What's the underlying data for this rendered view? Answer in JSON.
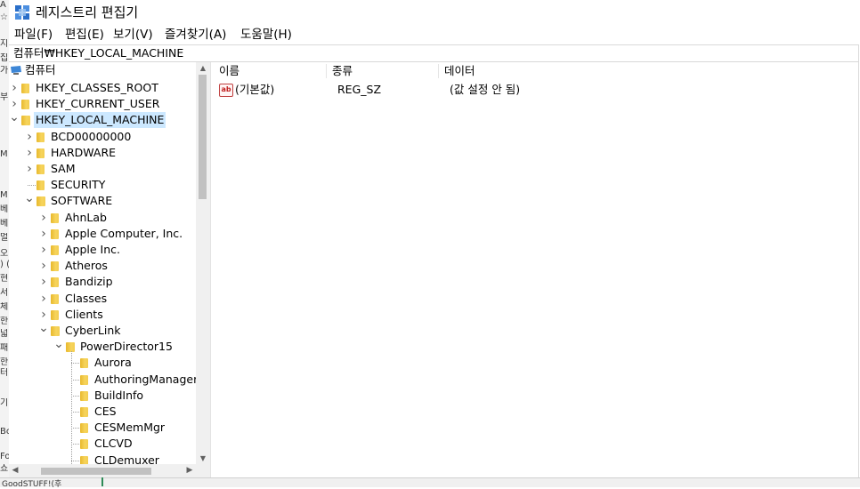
{
  "window": {
    "title": "레지스트리 편집기"
  },
  "menu": [
    "파일(F)",
    "편집(E)",
    "보기(V)",
    "즐겨찾기(A)",
    "도움말(H)"
  ],
  "address": "컴퓨터₩HKEY_LOCAL_MACHINE",
  "tree": {
    "root": "컴퓨터",
    "items": [
      {
        "label": "HKEY_CLASSES_ROOT",
        "level": 1,
        "state": "collapsed"
      },
      {
        "label": "HKEY_CURRENT_USER",
        "level": 1,
        "state": "collapsed"
      },
      {
        "label": "HKEY_LOCAL_MACHINE",
        "level": 1,
        "state": "expanded",
        "selected": true
      },
      {
        "label": "BCD00000000",
        "level": 2,
        "state": "collapsed"
      },
      {
        "label": "HARDWARE",
        "level": 2,
        "state": "collapsed"
      },
      {
        "label": "SAM",
        "level": 2,
        "state": "collapsed"
      },
      {
        "label": "SECURITY",
        "level": 2,
        "state": "leaf"
      },
      {
        "label": "SOFTWARE",
        "level": 2,
        "state": "expanded"
      },
      {
        "label": "AhnLab",
        "level": 3,
        "state": "collapsed"
      },
      {
        "label": "Apple Computer, Inc.",
        "level": 3,
        "state": "collapsed"
      },
      {
        "label": "Apple Inc.",
        "level": 3,
        "state": "collapsed"
      },
      {
        "label": "Atheros",
        "level": 3,
        "state": "collapsed"
      },
      {
        "label": "Bandizip",
        "level": 3,
        "state": "collapsed"
      },
      {
        "label": "Classes",
        "level": 3,
        "state": "collapsed"
      },
      {
        "label": "Clients",
        "level": 3,
        "state": "collapsed"
      },
      {
        "label": "CyberLink",
        "level": 3,
        "state": "expanded"
      },
      {
        "label": "PowerDirector15",
        "level": 4,
        "state": "expanded"
      },
      {
        "label": "Aurora",
        "level": 5,
        "state": "leaf"
      },
      {
        "label": "AuthoringManager",
        "level": 5,
        "state": "leaf"
      },
      {
        "label": "BuildInfo",
        "level": 5,
        "state": "leaf"
      },
      {
        "label": "CES",
        "level": 5,
        "state": "leaf"
      },
      {
        "label": "CESMemMgr",
        "level": 5,
        "state": "leaf"
      },
      {
        "label": "CLCVD",
        "level": 5,
        "state": "leaf"
      },
      {
        "label": "CLDemuxer",
        "level": 5,
        "state": "leaf"
      }
    ]
  },
  "columns": [
    "이름",
    "종류",
    "데이터"
  ],
  "values": [
    {
      "name": "(기본값)",
      "type": "REG_SZ",
      "data": "(값 설정 안 됨)",
      "icon": "ab"
    }
  ],
  "background_strip": {
    "left_chars": [
      "A",
      "☆",
      "지",
      "집",
      "가",
      "부",
      "M",
      "M",
      "베",
      "베",
      "멀",
      "오",
      ") (",
      "현",
      "서",
      "체",
      "한",
      "넓",
      "패",
      "한",
      "터",
      "기",
      "Bo",
      "Fo",
      "쇼"
    ],
    "bottom_text": "GoodSTUFF!(후"
  }
}
